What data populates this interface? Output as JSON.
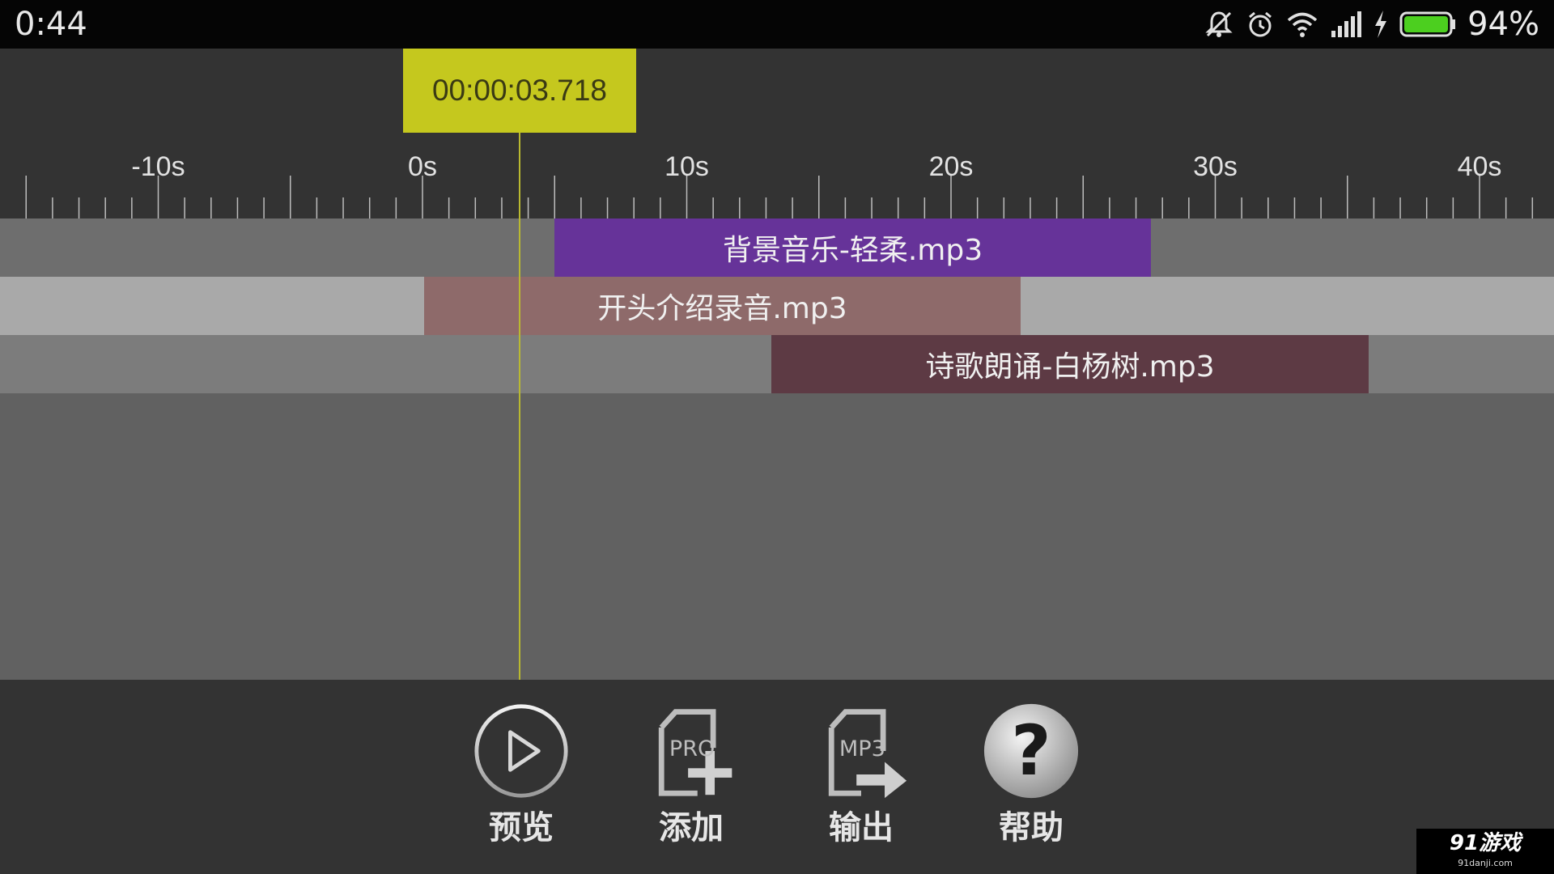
{
  "status_bar": {
    "time": "0:44",
    "battery_percent": "94%",
    "icons": [
      "silent-icon",
      "alarm-icon",
      "wifi-icon",
      "signal-icon",
      "charging-icon",
      "battery-icon"
    ],
    "battery_color": "#4ccf1f"
  },
  "timeline": {
    "playhead_time": "00:00:03.718",
    "ruler_labels": [
      "-10s",
      "0s",
      "10s",
      "20s",
      "30s",
      "40s"
    ],
    "accent_color": "#c5c81e"
  },
  "tracks": [
    {
      "clip_label": "背景音乐-轻柔.mp3",
      "clip_color": "#663399",
      "lane_color": "#6e6e6e"
    },
    {
      "clip_label": "开头介绍录音.mp3",
      "clip_color": "#8e6a6a",
      "lane_color": "#a9a9a9"
    },
    {
      "clip_label": "诗歌朗诵-白杨树.mp3",
      "clip_color": "#5d3a44",
      "lane_color": "#7c7c7c"
    }
  ],
  "toolbar": {
    "preview_label": "预览",
    "add_label": "添加",
    "add_icon_text": "PRO",
    "export_label": "输出",
    "export_icon_text": "MP3",
    "help_label": "帮助"
  },
  "watermark": {
    "main": "91游戏",
    "sub": "91danji.com"
  }
}
